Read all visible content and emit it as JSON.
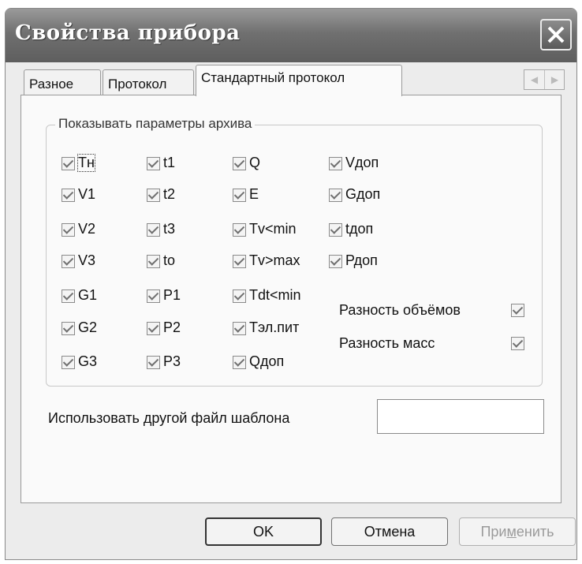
{
  "window": {
    "title": "Свойства прибора"
  },
  "tabs": [
    {
      "label": "Разное",
      "active": false
    },
    {
      "label": "Протокол",
      "active": false
    },
    {
      "label": "Стандартный протокол",
      "active": true
    }
  ],
  "group": {
    "legend": "Показывать параметры архива",
    "columns": [
      [
        "Тн",
        "V1",
        "V2",
        "V3",
        "G1",
        "G2",
        "G3"
      ],
      [
        "t1",
        "t2",
        "t3",
        "to",
        "P1",
        "P2",
        "P3"
      ],
      [
        "Q",
        "E",
        "Tv<min",
        "Tv>max",
        "Tdt<min",
        "Тэл.пит",
        "Qдоп"
      ],
      [
        "Vдоп",
        "Gдоп",
        "tдоп",
        "Рдоп"
      ]
    ],
    "extra": [
      {
        "label": "Разность объёмов",
        "checked": true
      },
      {
        "label": "Разность масс",
        "checked": true
      }
    ]
  },
  "template_file": {
    "label": "Использовать другой файл шаблона",
    "value": ""
  },
  "buttons": {
    "ok": "OK",
    "cancel": "Отмена",
    "apply_pre": "При",
    "apply_u": "м",
    "apply_post": "енить"
  },
  "colors": {
    "titlebar": "#6f6f6f",
    "dialog_bg": "#ececec",
    "panel_bg": "#fafafa"
  }
}
